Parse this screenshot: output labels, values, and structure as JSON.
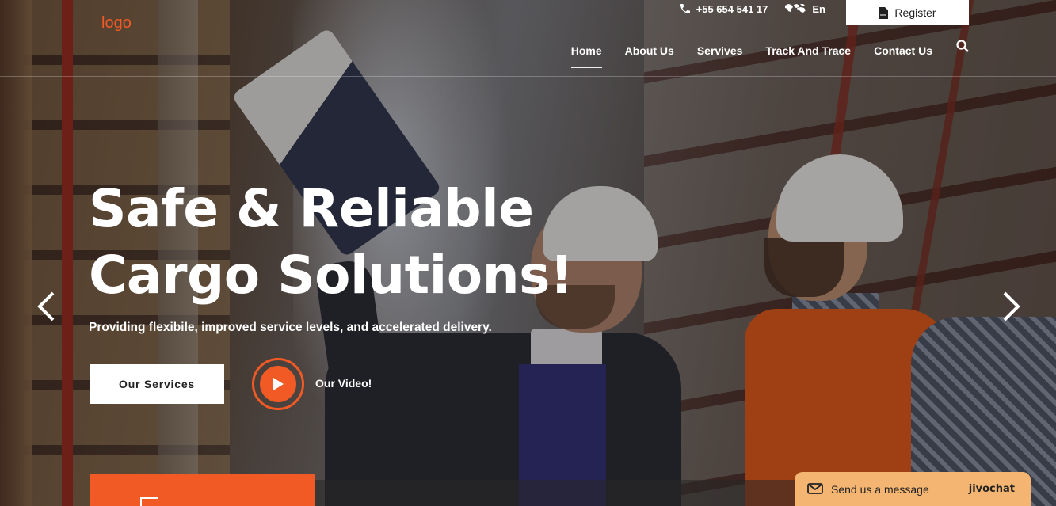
{
  "header": {
    "logo_text": "logo",
    "phone": "+55 654 541 17",
    "language": "En",
    "register_label": "Register"
  },
  "nav": {
    "items": [
      {
        "label": "Home",
        "active": true
      },
      {
        "label": "About Us",
        "active": false
      },
      {
        "label": "Servives",
        "active": false
      },
      {
        "label": "Track And Trace",
        "active": false
      },
      {
        "label": "Contact Us",
        "active": false
      }
    ]
  },
  "hero": {
    "title_line1": "Safe & Reliable",
    "title_line2": "Cargo Solutions!",
    "subtitle": "Providing flexibile, improved service levels, and accelerated delivery.",
    "primary_button": "Our Services",
    "video_label": "Our Video!"
  },
  "chat": {
    "message": "Send us a message",
    "brand": "jivochat"
  },
  "colors": {
    "accent": "#f15a24",
    "chat_bg": "#f4b572",
    "text_light": "#ffffff"
  },
  "icons": {
    "phone": "phone-icon",
    "globe": "world-map-icon",
    "register": "document-icon",
    "search": "search-icon",
    "play": "play-icon",
    "prev": "chevron-left-icon",
    "next": "chevron-right-icon",
    "chat": "chat-bubble-icon"
  }
}
